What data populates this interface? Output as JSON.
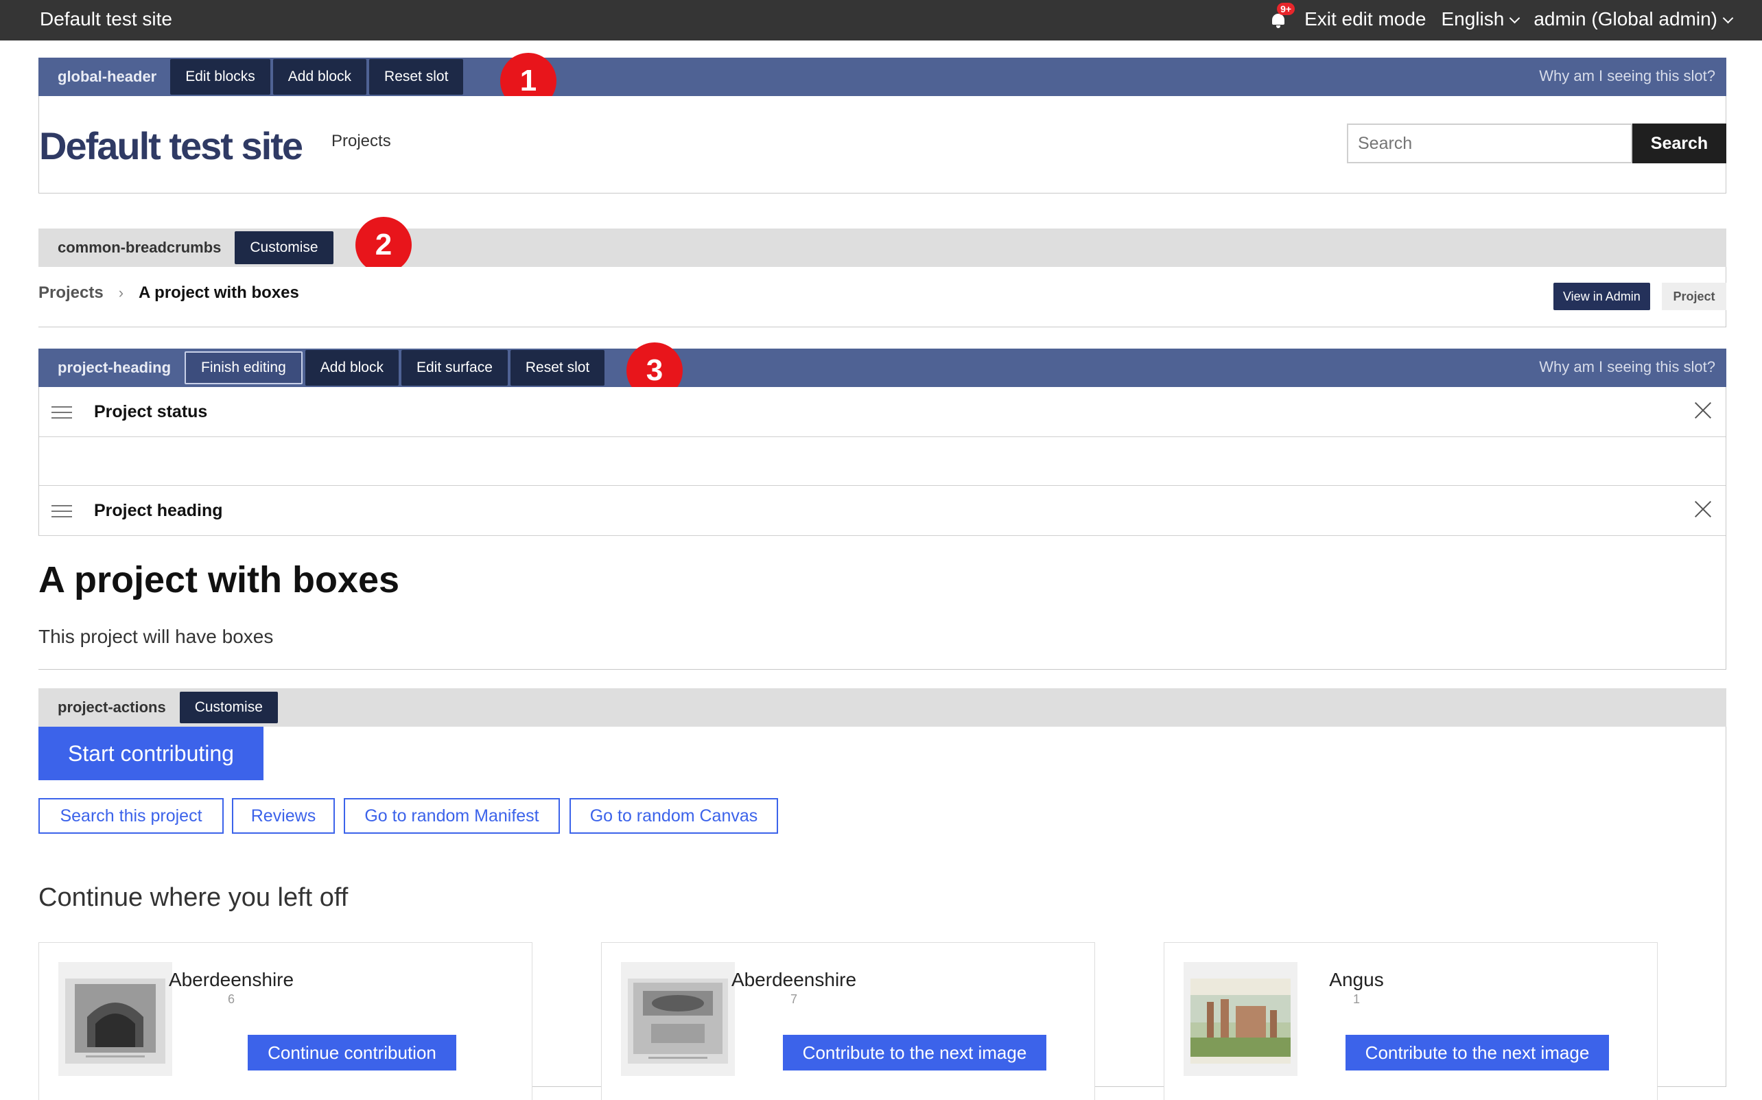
{
  "topbar": {
    "site_title": "Default test site",
    "notification_badge": "9+",
    "exit_edit_mode": "Exit edit mode",
    "language": "English",
    "user": "admin (Global admin)"
  },
  "slots": {
    "global_header": {
      "name": "global-header",
      "buttons": [
        "Edit blocks",
        "Add block",
        "Reset slot"
      ],
      "why": "Why am I seeing this slot?",
      "marker": "1"
    },
    "common_breadcrumbs": {
      "name": "common-breadcrumbs",
      "customise": "Customise",
      "marker": "2"
    },
    "project_heading": {
      "name": "project-heading",
      "buttons": [
        "Finish editing",
        "Add block",
        "Edit surface",
        "Reset slot"
      ],
      "why": "Why am I seeing this slot?",
      "marker": "3"
    },
    "project_actions": {
      "name": "project-actions",
      "customise": "Customise"
    }
  },
  "header": {
    "logo": "Default test site",
    "nav_projects": "Projects",
    "search_placeholder": "Search",
    "search_button": "Search"
  },
  "breadcrumbs": {
    "items": [
      "Projects",
      "A project with boxes"
    ],
    "view_in_admin": "View in Admin",
    "tag": "Project"
  },
  "blocks": {
    "project_status": "Project status",
    "project_heading": "Project heading"
  },
  "project": {
    "title": "A project with boxes",
    "description": "This project will have boxes"
  },
  "actions": {
    "start": "Start contributing",
    "links": [
      "Search this project",
      "Reviews",
      "Go to random Manifest",
      "Go to random Canvas"
    ]
  },
  "continue": {
    "heading": "Continue where you left off",
    "cards": [
      {
        "name": "Aberdeenshire",
        "count": "6",
        "button": "Continue contribution"
      },
      {
        "name": "Aberdeenshire",
        "count": "7",
        "button": "Contribute to the next image"
      },
      {
        "name": "Angus",
        "count": "1",
        "button": "Contribute to the next image"
      }
    ]
  },
  "colors": {
    "topbar": "#353535",
    "slot_blue": "#4f6294",
    "slot_grey": "#dedede",
    "slot_button": "#1d2947",
    "primary": "#3c63ea",
    "marker_red": "#e8151b"
  }
}
